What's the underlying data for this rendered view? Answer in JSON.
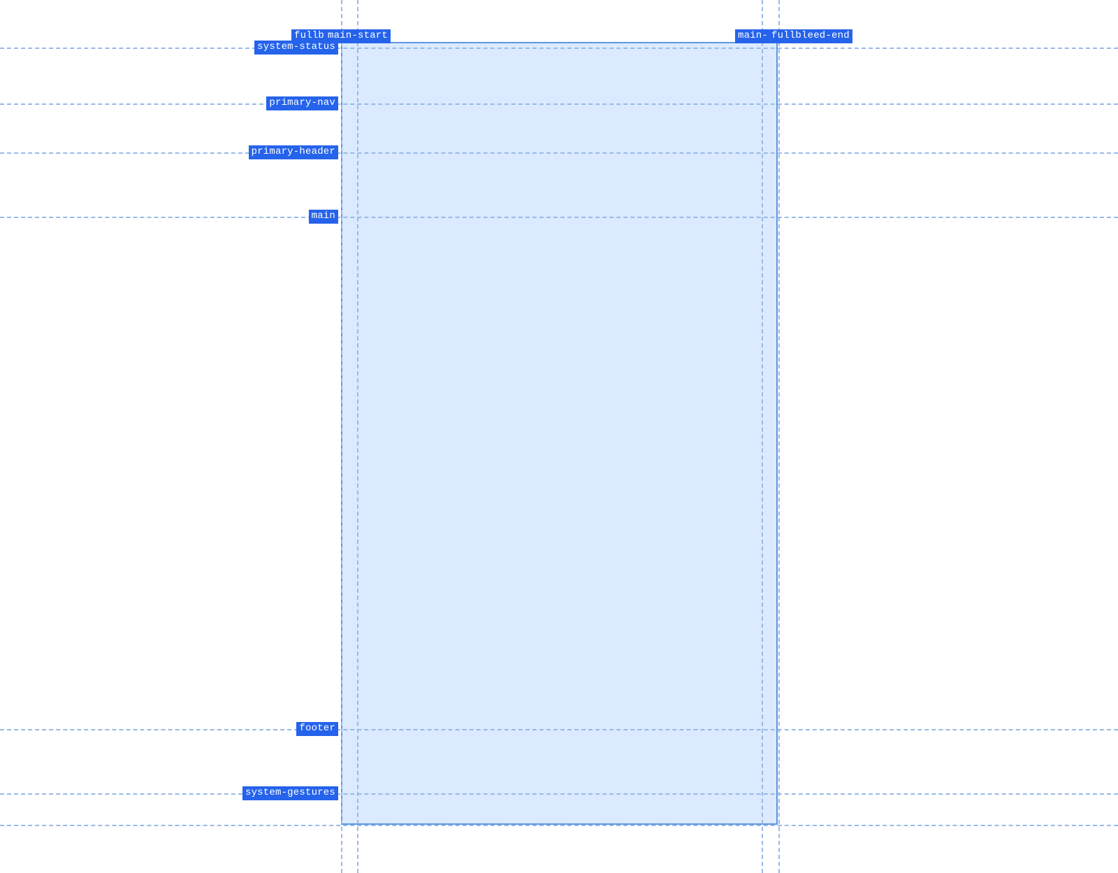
{
  "columns": {
    "fullbleed_start": "fullbleed-start",
    "main_start": "main-start",
    "main_end": "main-end",
    "fullbleed_end": "fullbleed-end"
  },
  "rows": {
    "system_status": "system-status",
    "primary_nav": "primary-nav",
    "primary_header": "primary-header",
    "main": "main",
    "footer": "footer",
    "system_gestures": "system-gestures"
  }
}
